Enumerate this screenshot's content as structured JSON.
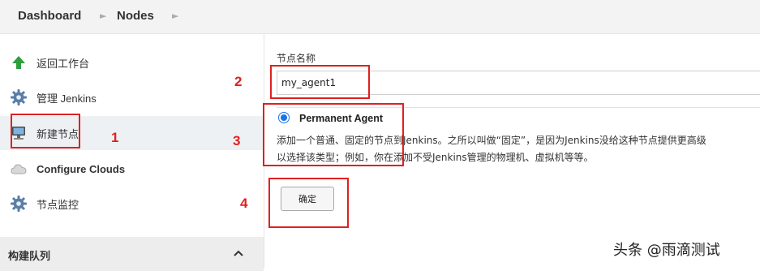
{
  "breadcrumb": {
    "items": [
      "Dashboard",
      "Nodes"
    ]
  },
  "sidebar": {
    "items": [
      {
        "label": "返回工作台",
        "icon": "up-arrow-icon"
      },
      {
        "label": "管理 Jenkins",
        "icon": "gear-icon"
      },
      {
        "label": "新建节点",
        "icon": "computer-icon"
      },
      {
        "label": "Configure Clouds",
        "icon": "cloud-icon"
      },
      {
        "label": "节点监控",
        "icon": "gear-icon"
      }
    ],
    "build_queue": {
      "label": "构建队列"
    }
  },
  "form": {
    "node_name_label": "节点名称",
    "node_name_value": "my_agent1",
    "radio_label": "Permanent Agent",
    "description_line1": "添加一个普通、固定的节点到Jenkins。之所以叫做“固定”，是因为Jenkins没给这种节点提供更高级",
    "description_line2": "以选择该类型；例如，你在添加不受Jenkins管理的物理机、虚拟机等等。",
    "ok_label": "确定"
  },
  "annotations": {
    "n1": "1",
    "n2": "2",
    "n3": "3",
    "n4": "4"
  },
  "watermark": "头条 @雨滴测试",
  "colors": {
    "annotation": "#e02020",
    "radio": "#1a73e8",
    "arrow": "#2e9e3e"
  }
}
